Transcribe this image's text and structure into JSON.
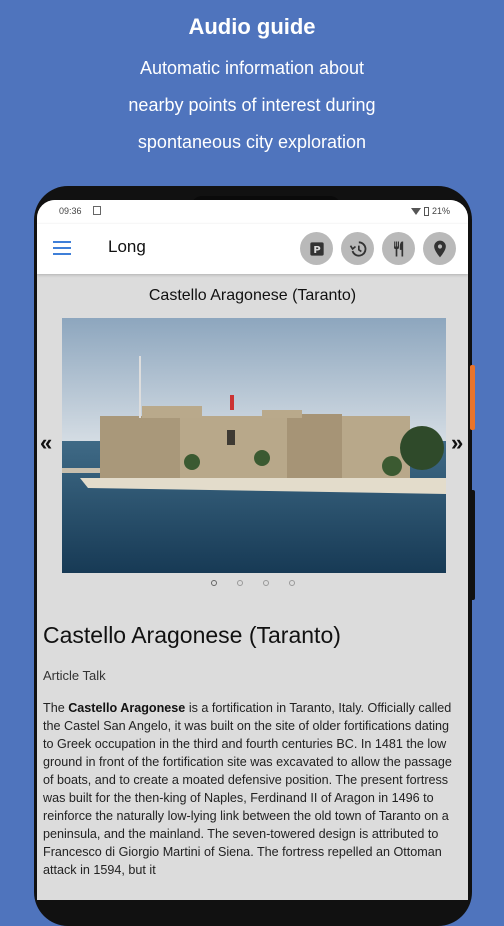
{
  "promo": {
    "title": "Audio guide",
    "line1": "Automatic information about",
    "line2": "nearby points of interest during",
    "line3": "spontaneous city exploration"
  },
  "statusbar": {
    "time": "09:36",
    "battery": "21%"
  },
  "appbar": {
    "title": "Long",
    "actions": [
      "parking-icon",
      "history-icon",
      "restaurant-icon",
      "location-pin-icon"
    ]
  },
  "place": {
    "title": "Castello Aragonese (Taranto)",
    "prev_label": "«",
    "next_label": "»",
    "slides_count": 4,
    "active_slide": 1
  },
  "article": {
    "title": "Castello Aragonese (Taranto)",
    "tabs": "Article Talk",
    "intro_prefix": "The ",
    "intro_bold": "Castello Aragonese",
    "body": " is a fortification in Taranto, Italy. Officially called the Castel San Angelo, it was built on the site of older fortifications dating to Greek occupation in the third and fourth centuries BC. In 1481 the low ground in front of the fortification site was excavated to allow the passage of boats, and to create a moated defensive position. The present fortress was built for the then-king of Naples, Ferdinand II of Aragon in 1496 to reinforce the naturally low-lying link between the old town of Taranto on a peninsula, and the mainland. The seven-towered design is attributed to Francesco di Giorgio Martini of Siena. The fortress repelled an Ottoman attack in 1594, but it"
  },
  "colors": {
    "background": "#4f74bd",
    "accent": "#3f7fd8"
  }
}
